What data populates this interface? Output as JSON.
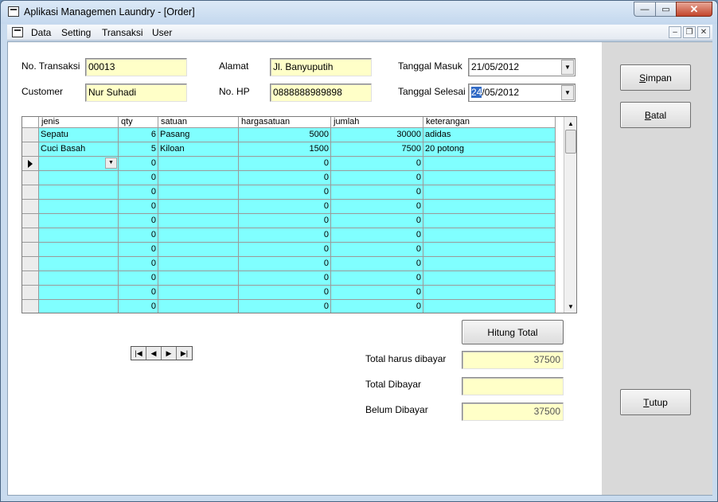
{
  "window": {
    "title": "Aplikasi Managemen Laundry - [Order]",
    "minimize_glyph": "—",
    "maximize_glyph": "▭",
    "close_glyph": "✕"
  },
  "menu": {
    "items": [
      "Data",
      "Setting",
      "Transaksi",
      "User"
    ],
    "mdi_minimize": "–",
    "mdi_restore": "❐",
    "mdi_close": "✕"
  },
  "form": {
    "no_transaksi_label": "No. Transaksi",
    "no_transaksi": "00013",
    "customer_label": "Customer",
    "customer": "Nur Suhadi",
    "alamat_label": "Alamat",
    "alamat": "Jl. Banyuputih",
    "nohp_label": "No. HP",
    "nohp": "0888888989898",
    "tanggal_masuk_label": "Tanggal Masuk",
    "tanggal_masuk": "21/05/2012",
    "tanggal_selesai_label": "Tanggal Selesai",
    "tanggal_selesai_sel": "24",
    "tanggal_selesai_rest": "/05/2012"
  },
  "grid": {
    "columns": [
      "jenis",
      "qty",
      "satuan",
      "hargasatuan",
      "jumlah",
      "keterangan"
    ],
    "rows": [
      [
        "Sepatu",
        "6",
        "Pasang",
        "5000",
        "30000",
        "adidas"
      ],
      [
        "Cuci Basah",
        "5",
        "Kiloan",
        "1500",
        "7500",
        "20 potong"
      ],
      [
        "",
        "0",
        "",
        "0",
        "0",
        ""
      ],
      [
        "",
        "0",
        "",
        "0",
        "0",
        ""
      ],
      [
        "",
        "0",
        "",
        "0",
        "0",
        ""
      ],
      [
        "",
        "0",
        "",
        "0",
        "0",
        ""
      ],
      [
        "",
        "0",
        "",
        "0",
        "0",
        ""
      ],
      [
        "",
        "0",
        "",
        "0",
        "0",
        ""
      ],
      [
        "",
        "0",
        "",
        "0",
        "0",
        ""
      ],
      [
        "",
        "0",
        "",
        "0",
        "0",
        ""
      ],
      [
        "",
        "0",
        "",
        "0",
        "0",
        ""
      ],
      [
        "",
        "0",
        "",
        "0",
        "0",
        ""
      ],
      [
        "",
        "0",
        "",
        "0",
        "0",
        ""
      ]
    ],
    "current_row": 2
  },
  "totals": {
    "hitung_label": "Hitung Total",
    "total_harus_label": "Total harus dibayar",
    "total_harus": "37500",
    "total_dibayar_label": "Total Dibayar",
    "total_dibayar": "",
    "belum_label": "Belum Dibayar",
    "belum": "37500"
  },
  "navigator": {
    "first": "|◀",
    "prev": "◀",
    "next": "▶",
    "last": "▶|"
  },
  "buttons": {
    "simpan_key": "S",
    "simpan_rest": "impan",
    "batal_key": "B",
    "batal_rest": "atal",
    "tutup_key": "T",
    "tutup_rest": "utup"
  }
}
